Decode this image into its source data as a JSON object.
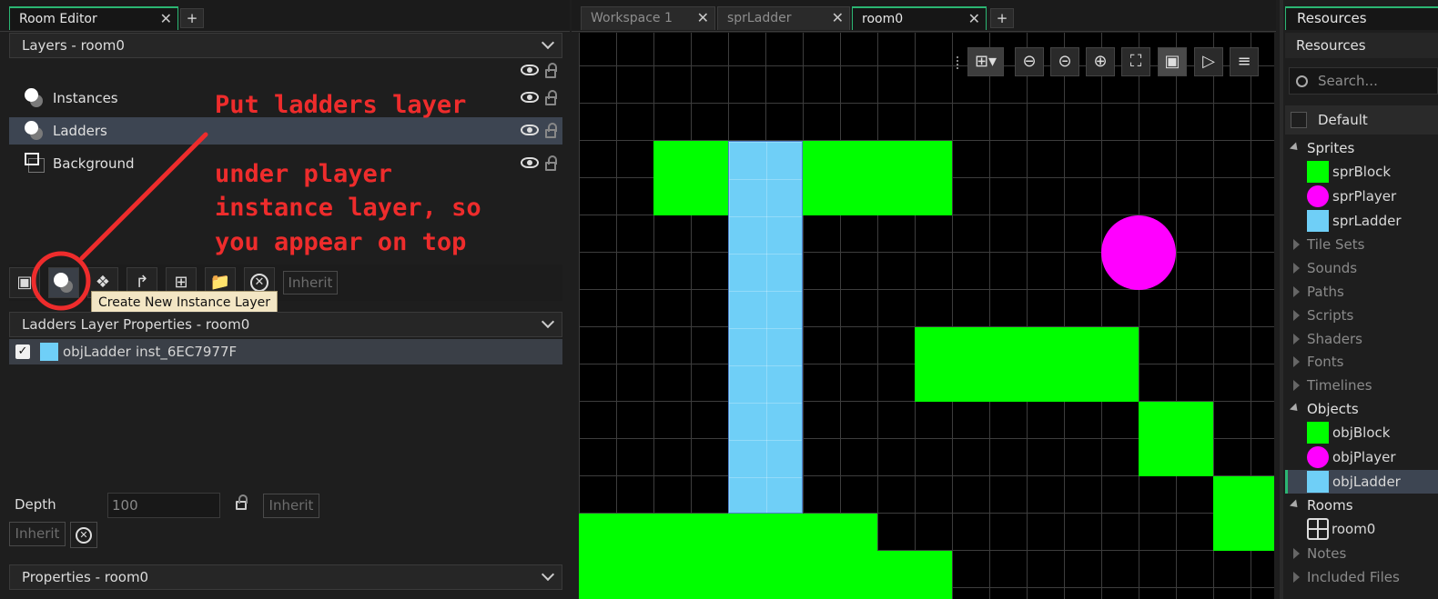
{
  "left_tab": {
    "title": "Room Editor",
    "close": "✕",
    "add": "+"
  },
  "layers_panel": {
    "title": "Layers - room0"
  },
  "layers": [
    {
      "name": "Instances"
    },
    {
      "name": "Ladders"
    },
    {
      "name": "Background"
    }
  ],
  "toolbar": {
    "inherit": "Inherit",
    "tooltip": "Create New Instance Layer"
  },
  "annotation": {
    "lines": [
      "Put ladders layer",
      "under player",
      "instance layer, so",
      "you appear on top"
    ]
  },
  "props_panel": {
    "title": "Ladders Layer Properties - room0"
  },
  "instance": {
    "object": "objLadder",
    "id": "inst_6EC7977F",
    "checked": true
  },
  "depth": {
    "label": "Depth",
    "value": "100",
    "inherit": "Inherit",
    "inherit2": "Inherit"
  },
  "room_props": {
    "title": "Properties - room0"
  },
  "center_tabs": [
    {
      "label": "Workspace 1",
      "close": "✕"
    },
    {
      "label": "sprLadder",
      "close": "✕"
    },
    {
      "label": "room0",
      "close": "✕"
    }
  ],
  "center_add": "+",
  "resources": {
    "tab": "Resources",
    "header": "Resources",
    "search_placeholder": "Search...",
    "default": "Default",
    "sprites": "Sprites",
    "sprite_items": [
      "sprBlock",
      "sprPlayer",
      "sprLadder"
    ],
    "tile_sets": "Tile Sets",
    "sounds": "Sounds",
    "paths": "Paths",
    "scripts": "Scripts",
    "shaders": "Shaders",
    "fonts": "Fonts",
    "timelines": "Timelines",
    "objects": "Objects",
    "object_items": [
      "objBlock",
      "objPlayer",
      "objLadder"
    ],
    "rooms": "Rooms",
    "room_items": [
      "room0"
    ],
    "notes": "Notes",
    "included_files": "Included Files"
  },
  "colors": {
    "block": "#00ff00",
    "ladder": "#6fcff7",
    "player": "#ff00ff",
    "accent": "#2bb673",
    "annotation": "#ee2c2c"
  }
}
